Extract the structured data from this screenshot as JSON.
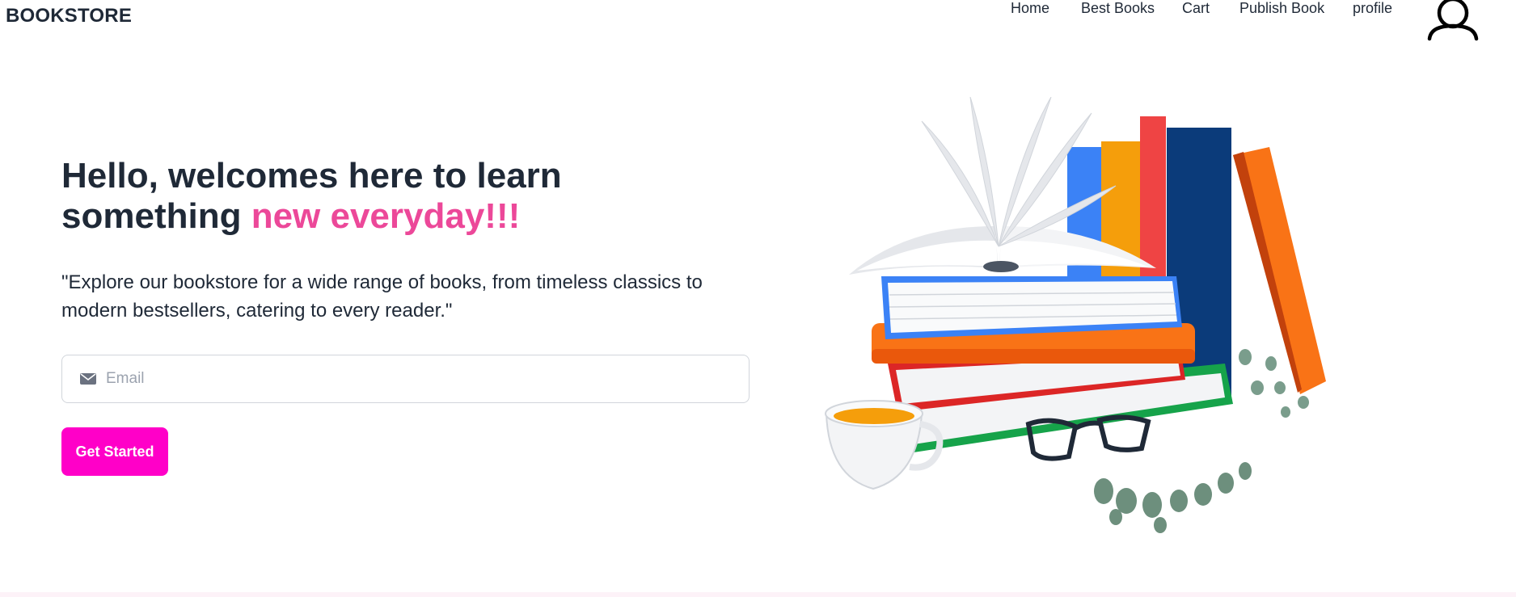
{
  "header": {
    "brand": "BOOKSTORE",
    "nav": [
      {
        "label": "Home"
      },
      {
        "label": "Best Books"
      },
      {
        "label": "Cart"
      },
      {
        "label": "Publish Book"
      },
      {
        "label": "profile"
      }
    ],
    "avatar_icon": "user-icon"
  },
  "hero": {
    "title_part1": "Hello, welcomes here to learn something ",
    "title_accent": "new everyday!!!",
    "description": "\"Explore our bookstore for a wide range of books, from timeless classics to modern bestsellers, catering to every reader.\"",
    "email_placeholder": "Email",
    "email_icon": "envelope-icon",
    "cta_label": "Get Started",
    "image": "books-illustration"
  },
  "colors": {
    "accent": "#ec4899",
    "button": "#ff00c8",
    "text": "#1f2937"
  }
}
